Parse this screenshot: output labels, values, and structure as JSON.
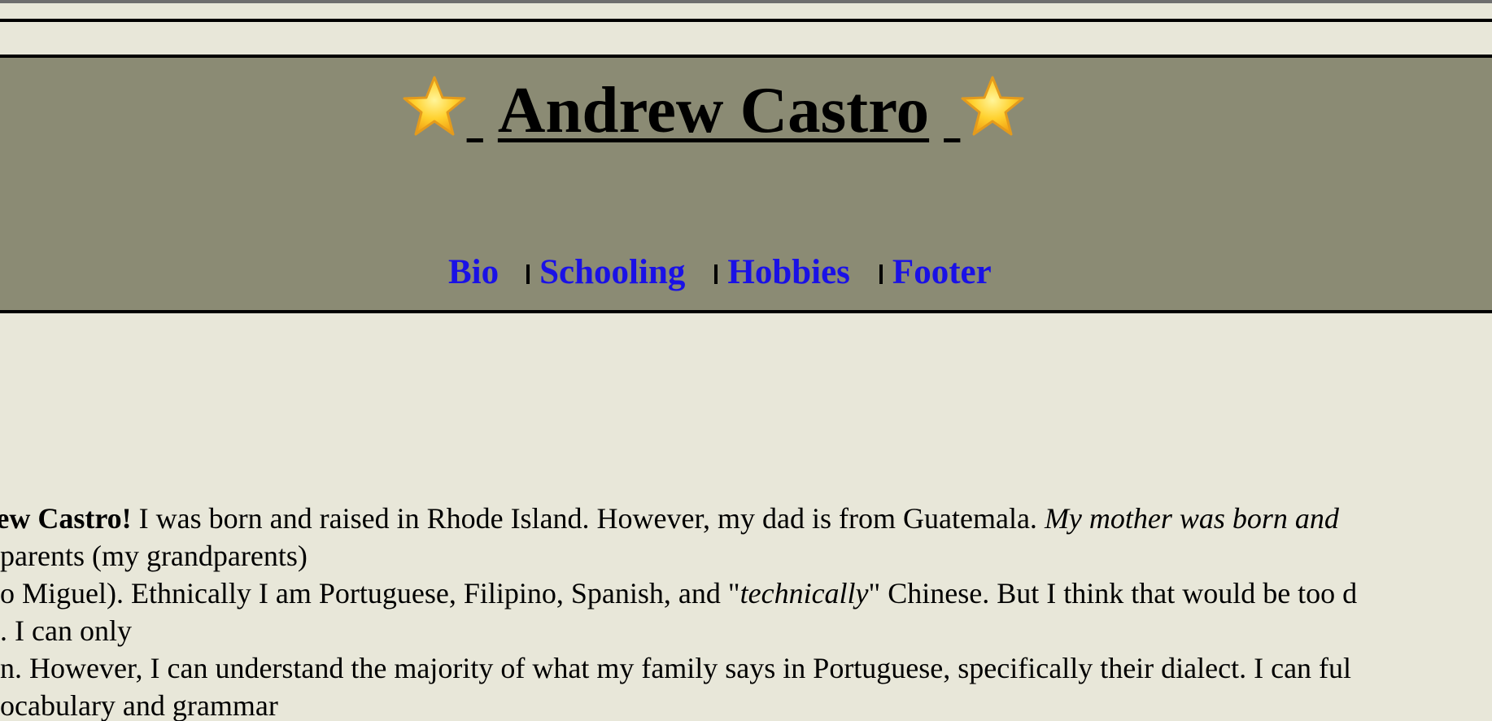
{
  "header": {
    "title": "Andrew Castro",
    "title_icon_left": "star-icon",
    "title_icon_right": "star-icon",
    "background_color": "#8b8b74"
  },
  "nav": {
    "link_color": "#1a11e6",
    "separator": "I",
    "items": [
      {
        "label": "Bio"
      },
      {
        "label": "Schooling"
      },
      {
        "label": "Hobbies"
      },
      {
        "label": "Footer"
      }
    ]
  },
  "bio": {
    "line1_bold": "Andrew Castro!",
    "line1_text": " I was born and raised in Rhode Island. However, my dad is from Guatemala. ",
    "line1_italic": "My mother was born and",
    "line2_text": "parents (my grandparents)",
    "line3_text": "o Miguel). Ethnically I am Portuguese, Filipino, Spanish, and \"",
    "line3_italic": "technically",
    "line3_text_after": "\" Chinese. But I think that would be too d",
    "line4_text": ". I can only",
    "line5_text": "n. However, I can understand the majority of what my family says in Portuguese, specifically their dialect. I can ful",
    "line6_text": "ocabulary and grammar"
  },
  "page": {
    "background_color": "#e8e7d9"
  }
}
